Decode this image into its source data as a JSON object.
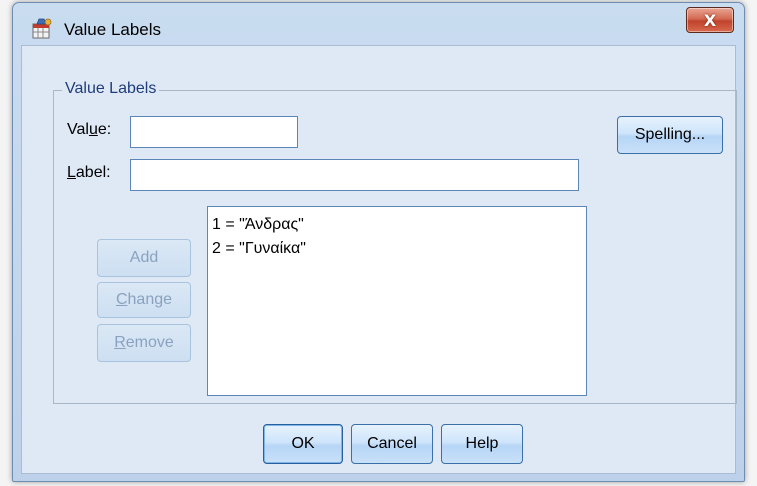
{
  "window": {
    "title": "Value Labels",
    "close_glyph": "X"
  },
  "group": {
    "legend": "Value Labels"
  },
  "value_field": {
    "label_pre": "Val",
    "label_u": "u",
    "label_post": "e:",
    "value": ""
  },
  "label_field": {
    "label_u": "L",
    "label_post": "abel:",
    "value": ""
  },
  "buttons": {
    "spelling": "Spelling...",
    "add": "Add",
    "change_u": "C",
    "change_post": "hange",
    "remove_u": "R",
    "remove_post": "emove",
    "ok": "OK",
    "cancel": "Cancel",
    "help": "Help"
  },
  "value_list": [
    "1 = \"Άνδρας\"",
    "2 = \"Γυναίκα\""
  ],
  "icons": {
    "app": "spss-value-labels-icon",
    "close": "close-icon"
  },
  "colors": {
    "window_frame": "#c9dcf0",
    "client_bg": "#dfe9f5",
    "close_button": "#c0432c",
    "button_face": "#cfe5fb",
    "disabled_text": "#8aa2bf",
    "legend_text": "#1f3d7a"
  }
}
